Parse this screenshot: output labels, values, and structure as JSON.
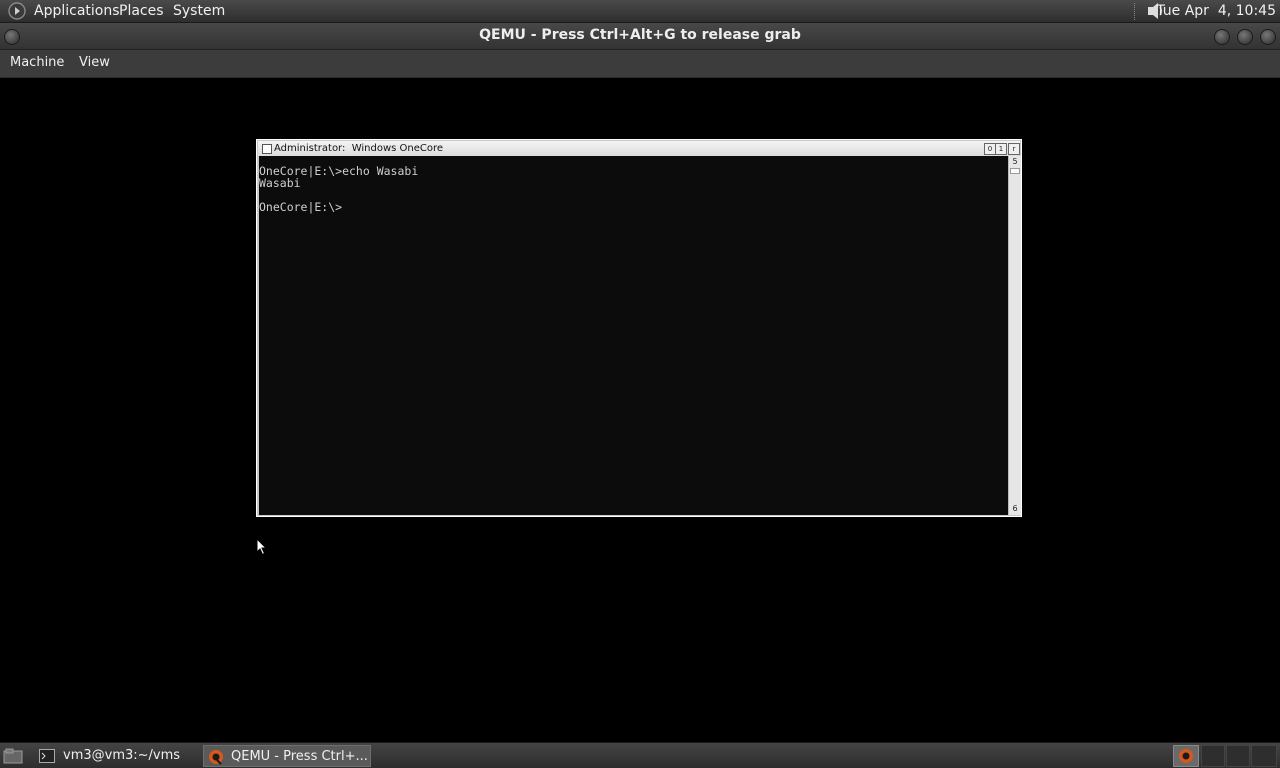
{
  "top_panel": {
    "menus": [
      "Applications",
      "Places",
      "System"
    ],
    "clock": "Tue Apr  4, 10:45"
  },
  "window": {
    "title": "QEMU - Press Ctrl+Alt+G to release grab"
  },
  "menubar": {
    "items": [
      "Machine",
      "View"
    ]
  },
  "console": {
    "title": "Administrator:  Windows OneCore",
    "caption_buttons": [
      "0",
      "1",
      "r"
    ],
    "lines": "OneCore|E:\\>echo Wasabi\nWasabi\n\nOneCore|E:\\>",
    "scroll_up": "5",
    "scroll_down": "6"
  },
  "taskbar": {
    "items": [
      {
        "label": "vm3@vm3:~/vms",
        "icon": "terminal-icon"
      },
      {
        "label": "QEMU - Press Ctrl+...",
        "icon": "qemu-icon"
      }
    ]
  }
}
